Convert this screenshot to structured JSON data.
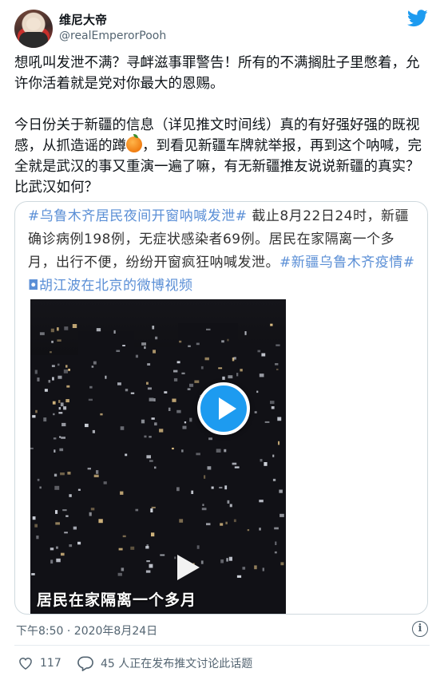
{
  "author": {
    "display_name": "维尼大帝",
    "handle": "@realEmperorPooh"
  },
  "tweet": {
    "line1": "想吼叫发泄不满？寻衅滋事罪警告！所有的不满搁肚子里憋着，允许你活着就是党对你最大的恩赐。",
    "line2a": "今日份关于新疆的信息（详见推文时间线）真的有好强好强的既视感，从抓造谣的蹲",
    "line2b": "，到看见新疆车牌就举报，再到这个呐喊，完全就是武汉的事又重演一遍了嘛，有无新疆推友说说新疆的真实？比武汉如何？"
  },
  "embed": {
    "hashtag1": "#乌鲁木齐居民夜间开窗呐喊发泄#",
    "text1": " 截止8月22日24时，新疆确诊病例198例，无症状感染者69例。居民在家隔离一个多月，出行不便，纷纷开窗疯狂呐喊发泄。",
    "hashtag2": "#新疆乌鲁木齐疫情#",
    "link_text": " ◘胡江波在北京的微博视频",
    "video_caption": "居民在家隔离一个多月"
  },
  "footer": {
    "timestamp": "下午8:50 · 2020年8月24日",
    "like_count": "117",
    "reply_text": "45 人正在发布推文讨论此话题",
    "info_glyph": "i"
  },
  "colors": {
    "accent": "#1d9bf0",
    "text": "#0f1419",
    "muted": "#536471",
    "link": "#5b8fd6"
  }
}
